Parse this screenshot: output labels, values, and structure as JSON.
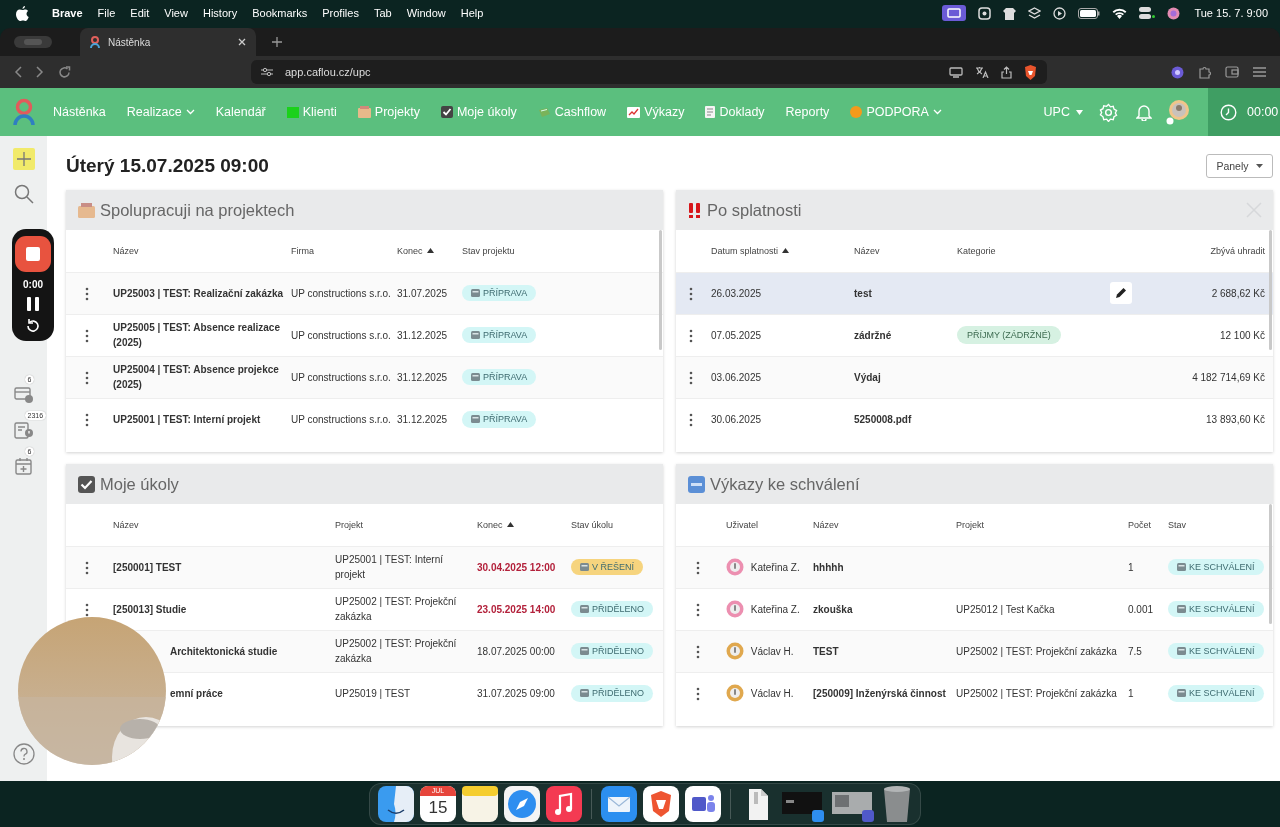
{
  "menubar": {
    "app": "Brave",
    "menus": [
      "File",
      "Edit",
      "View",
      "History",
      "Bookmarks",
      "Profiles",
      "Tab",
      "Window",
      "Help"
    ],
    "clock": "Tue 15. 7.  9:00"
  },
  "browser": {
    "tab": "Nástěnka",
    "url": "app.caflou.cz/upc"
  },
  "nav": {
    "items": [
      {
        "label": "Nástěnka",
        "dropdown": false
      },
      {
        "label": "Realizace",
        "dropdown": true
      },
      {
        "label": "Kalendář",
        "dropdown": false
      },
      {
        "label": "Klienti",
        "dropdown": false
      },
      {
        "label": "Projekty",
        "dropdown": false
      },
      {
        "label": "Moje úkoly",
        "dropdown": false
      },
      {
        "label": "Cashflow",
        "dropdown": false
      },
      {
        "label": "Výkazy",
        "dropdown": false
      },
      {
        "label": "Doklady",
        "dropdown": false
      },
      {
        "label": "Reporty",
        "dropdown": false
      },
      {
        "label": "PODPORA",
        "dropdown": true
      }
    ],
    "workspace": "UPC",
    "timer": "00:00"
  },
  "sidebar": {
    "badges": [
      "6",
      "2316",
      "6"
    ]
  },
  "recorder": {
    "time": "0:00"
  },
  "page": {
    "title": "Úterý 15.07.2025 09:00",
    "panels_button": "Panely"
  },
  "projects": {
    "title": "Spolupracuji na projektech",
    "columns": [
      {
        "label": "Název",
        "sorted": false
      },
      {
        "label": "Firma",
        "sorted": false
      },
      {
        "label": "Konec",
        "sorted": true
      },
      {
        "label": "Stav projektu",
        "sorted": false
      }
    ],
    "rows": [
      {
        "name": "UP25003 | TEST: Realizační zakázka",
        "company": "UP constructions s.r.o.",
        "end": "31.07.2025",
        "status": {
          "label": "PŘÍPRAVA",
          "color": "#d3f6f6"
        }
      },
      {
        "name": "UP25005 | TEST: Absence realizace (2025)",
        "company": "UP constructions s.r.o.",
        "end": "31.12.2025",
        "status": {
          "label": "PŘÍPRAVA",
          "color": "#d3f6f6"
        }
      },
      {
        "name": "UP25004 | TEST: Absence projekce (2025)",
        "company": "UP constructions s.r.o.",
        "end": "31.12.2025",
        "status": {
          "label": "PŘÍPRAVA",
          "color": "#d3f6f6"
        }
      },
      {
        "name": "UP25001 | TEST: Interní projekt",
        "company": "UP constructions s.r.o.",
        "end": "31.12.2025",
        "status": {
          "label": "PŘÍPRAVA",
          "color": "#d3f6f6"
        }
      }
    ]
  },
  "overdue": {
    "title": "Po splatnosti",
    "columns": [
      {
        "label": "Datum splatnosti",
        "sorted": true
      },
      {
        "label": "Název",
        "sorted": false
      },
      {
        "label": "Kategorie",
        "sorted": false
      },
      {
        "label": "Zbývá uhradit",
        "sorted": false
      }
    ],
    "rows": [
      {
        "due": "26.03.2025",
        "name": "test",
        "remaining": "2 688,62 Kč",
        "highlighted": true
      },
      {
        "due": "07.05.2025",
        "name": "zádržné",
        "category": {
          "label": "PŘÍJMY (ZÁDRŽNÉ)",
          "color": "#d6f1e2"
        },
        "remaining": "12 100 Kč",
        "highlighted": false
      },
      {
        "due": "03.06.2025",
        "name": "Výdaj",
        "remaining": "4 182 714,69 Kč",
        "highlighted": false
      },
      {
        "due": "30.06.2025",
        "name": "5250008.pdf",
        "remaining": "13 893,60 Kč",
        "highlighted": false
      }
    ]
  },
  "tasks": {
    "title": "Moje úkoly",
    "columns": [
      {
        "label": "Název",
        "sorted": false
      },
      {
        "label": "Projekt",
        "sorted": false
      },
      {
        "label": "Konec",
        "sorted": true
      },
      {
        "label": "Stav úkolu",
        "sorted": false
      }
    ],
    "rows": [
      {
        "name": "[250001] TEST",
        "project": "UP25001 | TEST: Interní projekt",
        "end": "30.04.2025 12:00",
        "overdue": true,
        "status": {
          "label": "V ŘEŠENÍ",
          "color": "#f6d47e"
        }
      },
      {
        "name": "[250013] Studie",
        "project": "UP25002 | TEST: Projekční zakázka",
        "end": "23.05.2025 14:00",
        "overdue": true,
        "status": {
          "label": "PŘIDĚLENO",
          "color": "#d3f6f6"
        }
      },
      {
        "name": "Architektonická studie",
        "project": "UP25002 | TEST: Projekční zakázka",
        "end": "18.07.2025 00:00",
        "overdue": false,
        "status": {
          "label": "PŘIDĚLENO",
          "color": "#d3f6f6"
        }
      },
      {
        "name": "emní práce",
        "project": "UP25019 | TEST",
        "end": "31.07.2025 09:00",
        "overdue": false,
        "status": {
          "label": "PŘIDĚLENO",
          "color": "#d3f6f6"
        }
      }
    ]
  },
  "reports": {
    "title": "Výkazy ke schválení",
    "columns": [
      {
        "label": "Uživatel",
        "sorted": false
      },
      {
        "label": "Název",
        "sorted": false
      },
      {
        "label": "Projekt",
        "sorted": false
      },
      {
        "label": "Počet",
        "sorted": false
      },
      {
        "label": "Stav",
        "sorted": false
      }
    ],
    "rows": [
      {
        "user": "Kateřina Z.",
        "color": "#ec8fb0",
        "name": "hhhhh",
        "count": "1",
        "status": {
          "label": "KE SCHVÁLENÍ",
          "color": "#d3f6f6"
        }
      },
      {
        "user": "Kateřina Z.",
        "color": "#ec8fb0",
        "name": "zkouška",
        "project": "UP25012 | Test Kačka",
        "count": "0.001",
        "status": {
          "label": "KE SCHVÁLENÍ",
          "color": "#d3f6f6"
        }
      },
      {
        "user": "Václav H.",
        "color": "#e0a84e",
        "name": "TEST",
        "project": "UP25002 | TEST: Projekční zakázka",
        "count": "7.5",
        "status": {
          "label": "KE SCHVÁLENÍ",
          "color": "#d3f6f6"
        }
      },
      {
        "user": "Václav H.",
        "color": "#e0a84e",
        "name": "[250009] Inženýrská činnost",
        "project": "UP25002 | TEST: Projekční zakázka",
        "count": "1",
        "status": {
          "label": "KE SCHVÁLENÍ",
          "color": "#d3f6f6"
        }
      }
    ]
  },
  "dock": {
    "calendar_month": "JUL",
    "calendar_day": "15"
  }
}
